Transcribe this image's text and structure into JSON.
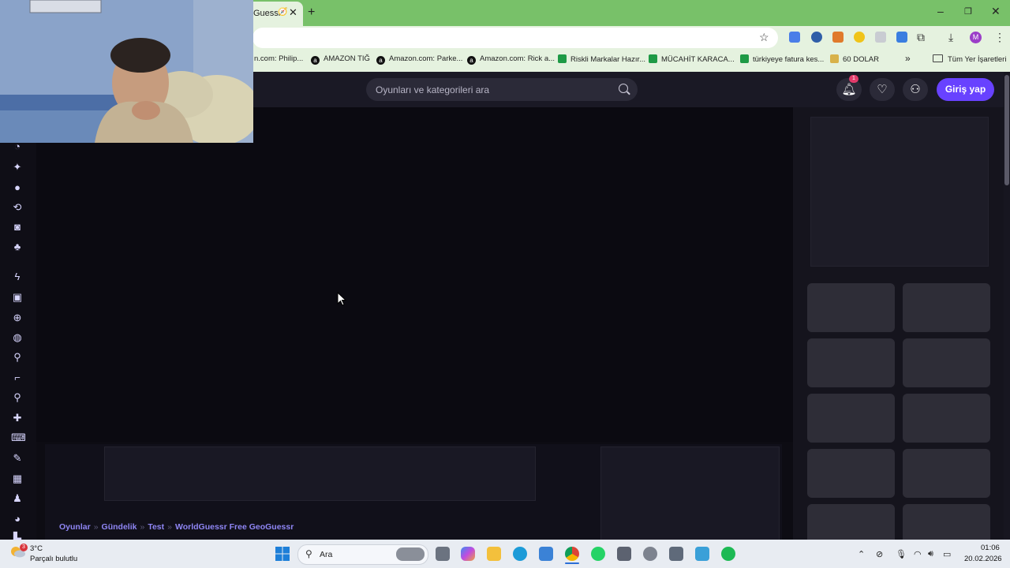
{
  "browser": {
    "tab_title": "Guessr",
    "new_tab_symbol": "+",
    "close_symbol": "✕",
    "window_controls": {
      "minimize": "–",
      "maximize": "❐",
      "close": "✕"
    },
    "star_symbol": "☆",
    "profile_initial": "M",
    "bookmarks": [
      {
        "label": "n.com: Philip...",
        "icon": "amazon"
      },
      {
        "label": "AMAZON TIĞ",
        "icon": "amazon"
      },
      {
        "label": "Amazon.com: Parke...",
        "icon": "amazon"
      },
      {
        "label": "Amazon.com: Rick a...",
        "icon": "amazon"
      },
      {
        "label": "Riskli Markalar Hazır...",
        "icon": "sheets"
      },
      {
        "label": "MÜCAHİT KARACA...",
        "icon": "sheets"
      },
      {
        "label": "türkiyeye fatura kes...",
        "icon": "sheets"
      },
      {
        "label": "60 DOLAR",
        "icon": "image"
      }
    ],
    "more_bookmarks": "»",
    "all_bookmarks": "Tüm Yer İşaretleri"
  },
  "site": {
    "search_placeholder": "Oyunları ve kategorileri ara",
    "notification_count": "1",
    "login_label": "Giriş yap",
    "breadcrumb": [
      "Oyunlar",
      "Gündelik",
      "Test",
      "WorldGuessr Free GeoGuessr"
    ],
    "breadcrumb_separator": "»"
  },
  "sidebar_icons": [
    "clock-icon",
    "sparkle-icon",
    "fire-icon",
    "refresh-icon",
    "twitch-icon",
    "users-icon",
    "lightning-icon",
    "car-icon",
    "crosshair-icon",
    "basketball-icon",
    "ring-icon",
    "gun-icon",
    "stickman-icon",
    "puzzle-icon",
    "gamepad-icon",
    "pencil-icon",
    "grid-icon",
    "character-icon",
    "pacman-icon",
    "building-icon"
  ],
  "taskbar": {
    "weather_temp": "3°C",
    "weather_desc": "Parçalı bulutlu",
    "weather_badge": "3",
    "search_label": "Ara",
    "time": "01:06",
    "date": "20.02.2026"
  }
}
